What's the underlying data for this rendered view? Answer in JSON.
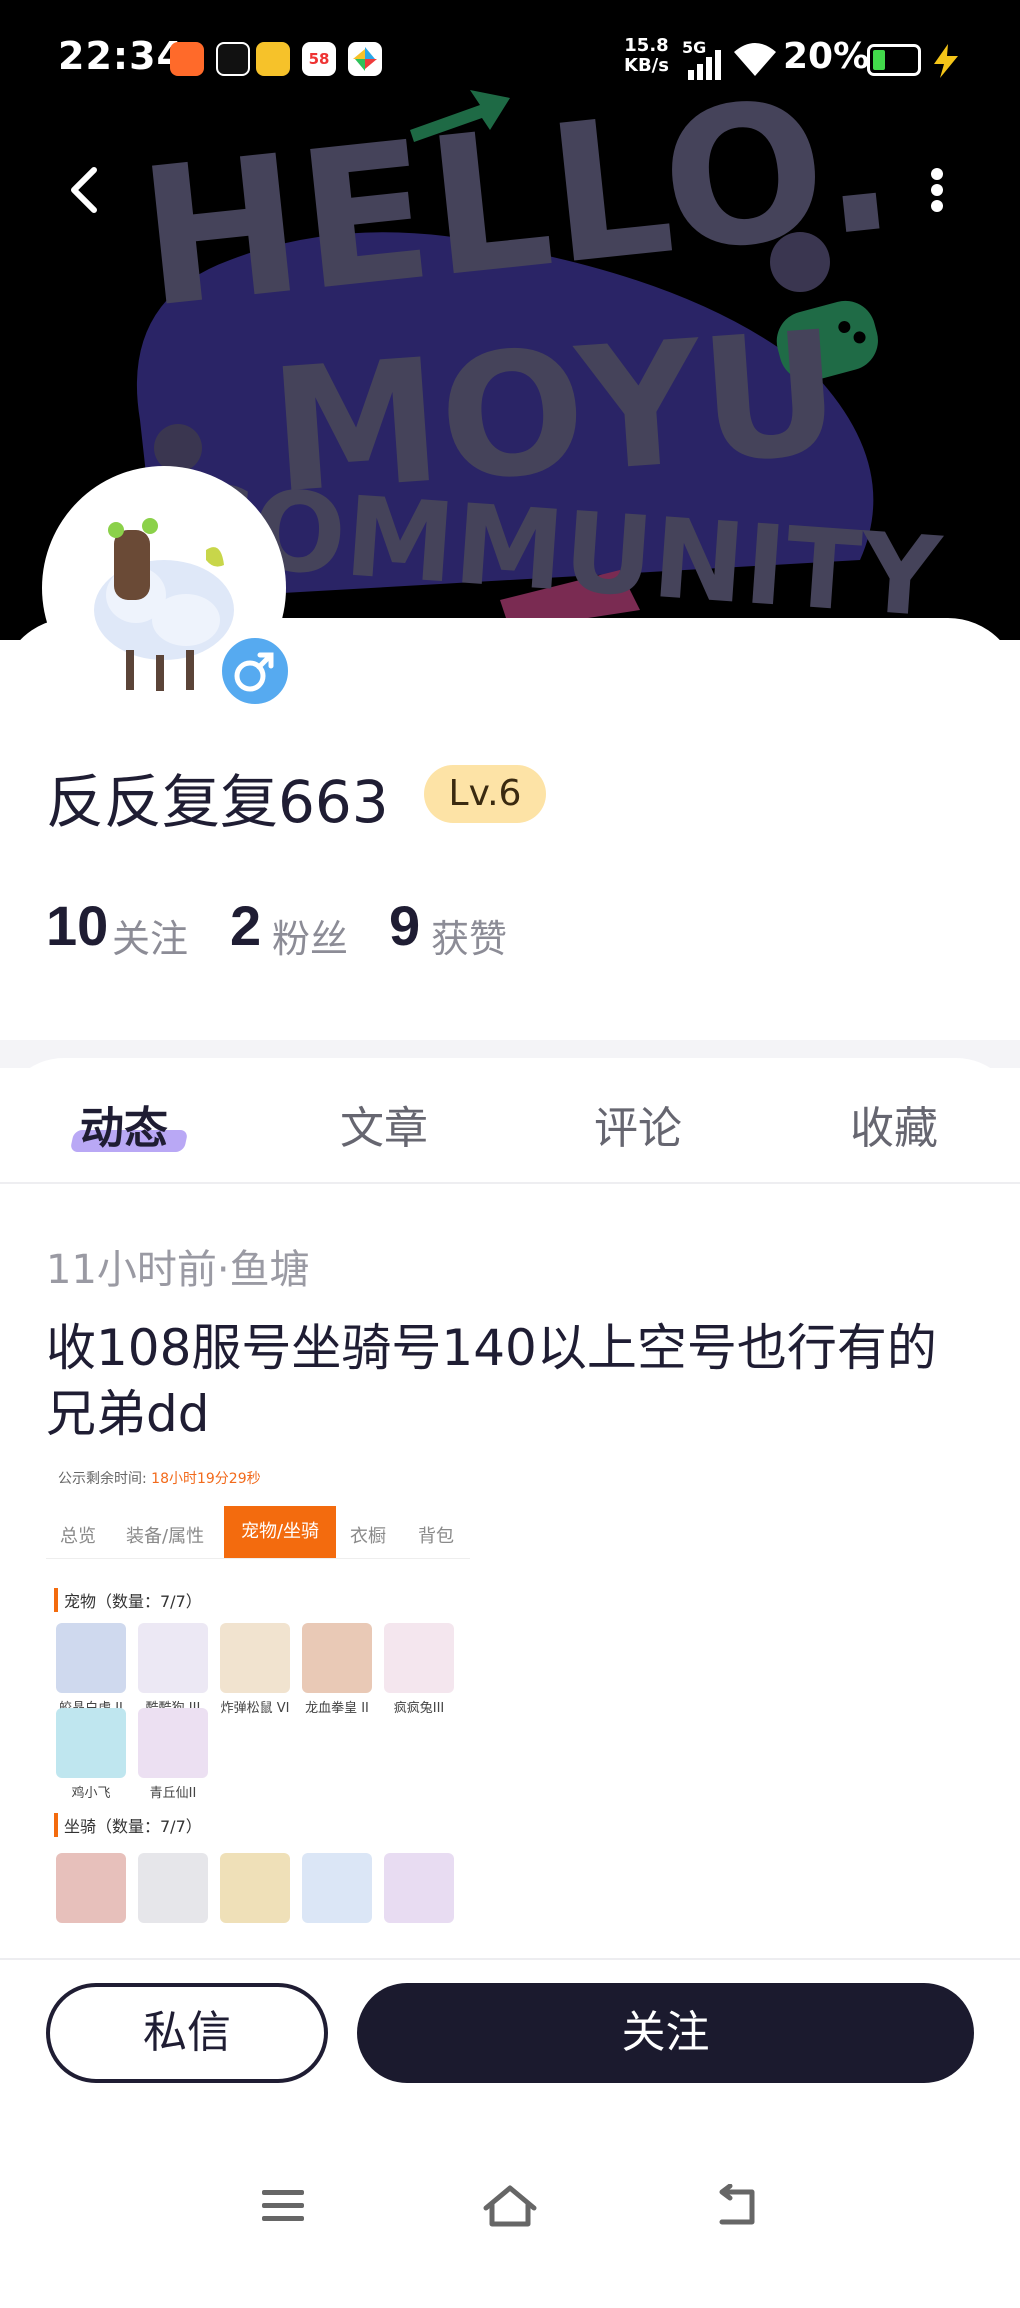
{
  "status_bar": {
    "time": "22:34",
    "net_speed_value": "15.8",
    "net_speed_unit": "KB/s",
    "network": "5G",
    "battery": "20%",
    "app_icons": [
      "app-a-icon",
      "tiktok-icon",
      "video-app-icon",
      "58-app-icon",
      "pinwheel-app-icon"
    ],
    "app_58_label": "58"
  },
  "hero": {
    "background_text_lines": [
      "HELLO.",
      "MOYU",
      "COMMUNITY"
    ]
  },
  "profile": {
    "username": "反反复复663",
    "level": "Lv.6",
    "gender": "male",
    "stats": [
      {
        "value": "10",
        "label": "关注"
      },
      {
        "value": "2",
        "label": "粉丝"
      },
      {
        "value": "9",
        "label": "获赞"
      }
    ]
  },
  "tabs": [
    {
      "label": "动态",
      "active": true
    },
    {
      "label": "文章",
      "active": false
    },
    {
      "label": "评论",
      "active": false
    },
    {
      "label": "收藏",
      "active": false
    }
  ],
  "post": {
    "meta": "11小时前·鱼塘",
    "title": "收108服号坐骑号140以上空号也行有的兄弟dd",
    "image": {
      "timer_label": "公示剩余时间: ",
      "timer_value": "18小时19分29秒",
      "tabs": [
        "总览",
        "装备/属性",
        "宠物/坐骑",
        "衣橱",
        "背包"
      ],
      "pets_section": "宠物（数量：7/7）",
      "pets": [
        "皎晶白虎 II",
        "酷酷狗 III",
        "炸弹松鼠 VI",
        "龙血拳皇 II",
        "疯疯兔III",
        "鸡小飞",
        "青丘仙II"
      ],
      "mounts_section": "坐骑（数量：7/7）"
    }
  },
  "actions": {
    "message": "私信",
    "follow": "关注"
  },
  "colors": {
    "dark_button": "#1b1a2e",
    "level_badge_bg": "#fde3a6",
    "tab_underline": "#b9a8f5",
    "accent_orange": "#f36b0e",
    "gender_blue": "#56aaf0"
  }
}
